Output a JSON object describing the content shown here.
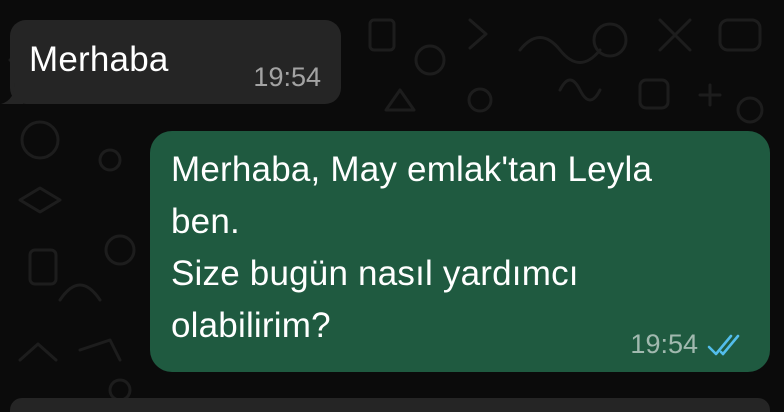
{
  "chat": {
    "messages": [
      {
        "direction": "incoming",
        "text": "Merhaba",
        "time": "19:54"
      },
      {
        "direction": "outgoing",
        "text": "Merhaba, May emlak'tan Leyla\nben.\nSize bugün nasıl yardımcı\nolabilirim?",
        "time": "19:54",
        "status_icon": "double-check-read-icon",
        "status_color": "#53bdeb"
      }
    ]
  },
  "colors": {
    "background": "#0b0b0b",
    "incoming_bubble": "#252525",
    "outgoing_bubble": "#1f5a40"
  }
}
